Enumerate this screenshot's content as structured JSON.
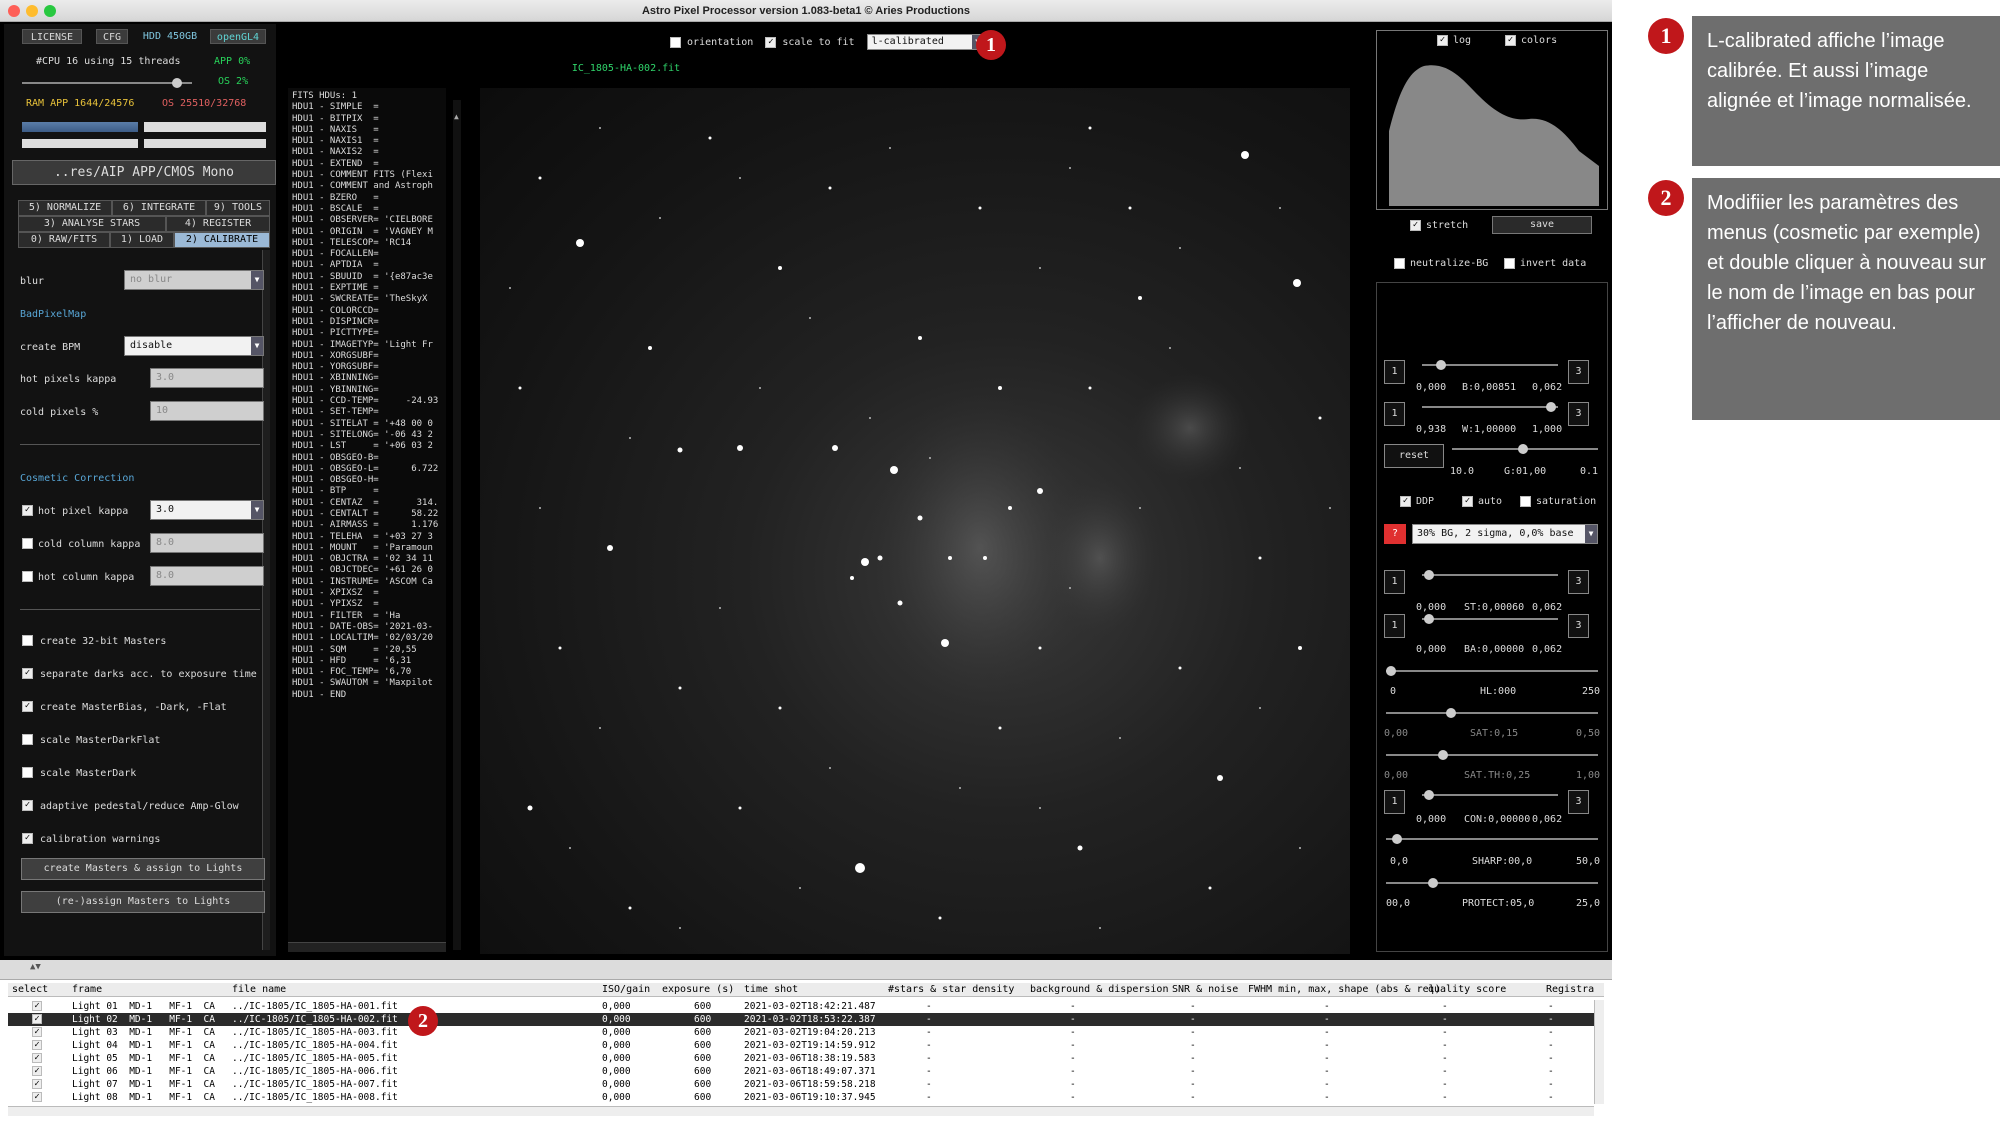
{
  "window": {
    "title": "Astro Pixel Processor version 1.083-beta1 © Aries Productions"
  },
  "top_left": {
    "license": "LICENSE",
    "cfg": "CFG",
    "hdd": "HDD 450GB",
    "opengl": "openGL4",
    "cpu": "#CPU 16  using 15 threads",
    "app_cpu": "APP 0%",
    "os_cpu": "OS 2%",
    "ram": "RAM  APP 1644/24576",
    "os_ram": "OS 25510/32768",
    "path_button": "..res/AIP APP/CMOS Mono"
  },
  "tabs": [
    "5) NORMALIZE",
    "6) INTEGRATE",
    "9) TOOLS",
    "3) ANALYSE STARS",
    "4) REGISTER",
    "0) RAW/FITS",
    "1) LOAD",
    "2) CALIBRATE"
  ],
  "calibrate": {
    "blur_label": "blur",
    "blur_value": "no blur",
    "badpixelmap_title": "BadPixelMap",
    "create_bpm_label": "create BPM",
    "create_bpm_value": "disable",
    "hot_pixels_kappa_label": "hot pixels kappa",
    "hot_pixels_kappa_value": "3.0",
    "cold_pixels_label": "cold pixels %",
    "cold_pixels_value": "10",
    "cosmetic_title": "Cosmetic Correction",
    "hot_pixel_kappa_label": "hot pixel kappa",
    "hot_pixel_kappa_value": "3.0",
    "cold_column_kappa_label": "cold column kappa",
    "cold_column_kappa_value": "8.0",
    "hot_column_kappa_label": "hot column kappa",
    "hot_column_kappa_value": "8.0",
    "options": [
      {
        "label": "create 32-bit Masters",
        "checked": false
      },
      {
        "label": "separate darks acc. to exposure time",
        "checked": true
      },
      {
        "label": "create MasterBias, -Dark, -Flat",
        "checked": true
      },
      {
        "label": "scale MasterDarkFlat",
        "checked": false
      },
      {
        "label": "scale MasterDark",
        "checked": false
      },
      {
        "label": "adaptive pedestal/reduce Amp-Glow",
        "checked": true
      },
      {
        "label": "calibration warnings",
        "checked": true
      }
    ],
    "create_masters_button": "create Masters & assign to Lights",
    "reassign_button": "(re-)assign Masters to Lights"
  },
  "fits_header": "FITS HDUs: 1\nHDU1 - SIMPLE  =\nHDU1 - BITPIX  =\nHDU1 - NAXIS   =\nHDU1 - NAXIS1  =\nHDU1 - NAXIS2  =\nHDU1 - EXTEND  =\nHDU1 - COMMENT FITS (Flexi\nHDU1 - COMMENT and Astroph\nHDU1 - BZERO   =\nHDU1 - BSCALE  =\nHDU1 - OBSERVER= 'CIELBORE\nHDU1 - ORIGIN  = 'VAGNEY M\nHDU1 - TELESCOP= 'RC14\nHDU1 - FOCALLEN=\nHDU1 - APTDIA  =\nHDU1 - SBUUID  = '{e87ac3e\nHDU1 - EXPTIME =\nHDU1 - SWCREATE= 'TheSkyX\nHDU1 - COLORCCD=\nHDU1 - DISPINCR=\nHDU1 - PICTTYPE=\nHDU1 - IMAGETYP= 'Light Fr\nHDU1 - XORGSUBF=\nHDU1 - YORGSUBF=\nHDU1 - XBINNING=\nHDU1 - YBINNING=\nHDU1 - CCD-TEMP=     -24.93\nHDU1 - SET-TEMP=\nHDU1 - SITELAT = '+48 00 0\nHDU1 - SITELONG= '-06 43 2\nHDU1 - LST     = '+06 03 2\nHDU1 - OBSGEO-B=\nHDU1 - OBSGEO-L=      6.722\nHDU1 - OBSGEO-H=\nHDU1 - BTP     =\nHDU1 - CENTAZ  =       314.\nHDU1 - CENTALT =      58.22\nHDU1 - AIRMASS =      1.176\nHDU1 - TELEHA  = '+03 27 3\nHDU1 - MOUNT   = 'Paramoun\nHDU1 - OBJCTRA = '02 34 11\nHDU1 - OBJCTDEC= '+61 26 0\nHDU1 - INSTRUME= 'ASCOM Ca\nHDU1 - XPIXSZ  =\nHDU1 - YPIXSZ  =\nHDU1 - FILTER  = 'Ha\nHDU1 - DATE-OBS= '2021-03-\nHDU1 - LOCALTIM= '02/03/20\nHDU1 - SQM     = '20,55\nHDU1 - HFD     = '6,31\nHDU1 - FOC_TEMP= '6,70\nHDU1 - SWAUTOM = 'Maxpilot\nHDU1 - END",
  "toolbar": {
    "orientation": "orientation",
    "scale_to_fit": "scale to fit",
    "mode": "l-calibrated",
    "filename": "IC_1805-HA-002.fit"
  },
  "right": {
    "log": "log",
    "colors": "colors",
    "stretch": "stretch",
    "save": "save",
    "neutralize": "neutralize-BG",
    "invert": "invert data",
    "b_left": "0,000",
    "b_mid": "B:0,00851",
    "b_right": "0,062",
    "w_left": "0,938",
    "w_mid": "W:1,00000",
    "w_right": "1,000",
    "reset": "reset",
    "g_left": "10.0",
    "g_mid": "G:01,00",
    "g_right": "0.1",
    "ddp": "DDP",
    "auto": "auto",
    "saturation": "saturation",
    "q": "?",
    "bg_select": "30% BG, 2 sigma, 0,0% base",
    "st_left": "0,000",
    "st_mid": "ST:0,00060",
    "st_right": "0,062",
    "ba_left": "0,000",
    "ba_mid": "BA:0,00000",
    "ba_right": "0,062",
    "hl_left": "0",
    "hl_mid": "HL:000",
    "hl_right": "250",
    "sat_left": "0,00",
    "sat_mid": "SAT:0,15",
    "sat_right": "0,50",
    "satth_left": "0,00",
    "satth_mid": "SAT.TH:0,25",
    "satth_right": "1,00",
    "con_left": "0,000",
    "con_mid": "CON:0,00000",
    "con_right": "0,062",
    "sharp_left": "0,0",
    "sharp_mid": "SHARP:00,0",
    "sharp_right": "50,0",
    "protect_left": "00,0",
    "protect_mid": "PROTECT:05,0",
    "protect_right": "25,0",
    "one": "1",
    "three": "3"
  },
  "table": {
    "columns": [
      "select",
      "frame",
      "file name",
      "ISO/gain",
      "exposure (s)",
      "time shot",
      "#stars & star density",
      "background & dispersion",
      "SNR & noise",
      "FWHM min, max, shape (abs & rel)",
      "quality score",
      "Registra"
    ],
    "rows": [
      {
        "frame": "Light 01  MD-1   MF-1  CA",
        "file": "../IC-1805/IC_1805-HA-001.fit",
        "iso": "0,000",
        "exp": "600",
        "time": "2021-03-02T18:42:21.487",
        "d": "-"
      },
      {
        "frame": "Light 02  MD-1   MF-1  CA",
        "file": "../IC-1805/IC_1805-HA-002.fit",
        "iso": "0,000",
        "exp": "600",
        "time": "2021-03-02T18:53:22.387",
        "d": "-"
      },
      {
        "frame": "Light 03  MD-1   MF-1  CA",
        "file": "../IC-1805/IC_1805-HA-003.fit",
        "iso": "0,000",
        "exp": "600",
        "time": "2021-03-02T19:04:20.213",
        "d": "-"
      },
      {
        "frame": "Light 04  MD-1   MF-1  CA",
        "file": "../IC-1805/IC_1805-HA-004.fit",
        "iso": "0,000",
        "exp": "600",
        "time": "2021-03-02T19:14:59.912",
        "d": "-"
      },
      {
        "frame": "Light 05  MD-1   MF-1  CA",
        "file": "../IC-1805/IC_1805-HA-005.fit",
        "iso": "0,000",
        "exp": "600",
        "time": "2021-03-06T18:38:19.583",
        "d": "-"
      },
      {
        "frame": "Light 06  MD-1   MF-1  CA",
        "file": "../IC-1805/IC_1805-HA-006.fit",
        "iso": "0,000",
        "exp": "600",
        "time": "2021-03-06T18:49:07.371",
        "d": "-"
      },
      {
        "frame": "Light 07  MD-1   MF-1  CA",
        "file": "../IC-1805/IC_1805-HA-007.fit",
        "iso": "0,000",
        "exp": "600",
        "time": "2021-03-06T18:59:58.218",
        "d": "-"
      },
      {
        "frame": "Light 08  MD-1   MF-1  CA",
        "file": "../IC-1805/IC_1805-HA-008.fit",
        "iso": "0,000",
        "exp": "600",
        "time": "2021-03-06T19:10:37.945",
        "d": "-"
      }
    ]
  },
  "callouts": [
    {
      "num": "1",
      "text": "L-calibrated affiche l’image calibrée. Et aussi l’image alignée et l’image normalisée."
    },
    {
      "num": "2",
      "text": "Modifiier les paramètres des menus (cosmetic par exemple) et double cliquer à nouveau sur le nom de l’image en bas pour l’afficher de nouveau."
    }
  ]
}
